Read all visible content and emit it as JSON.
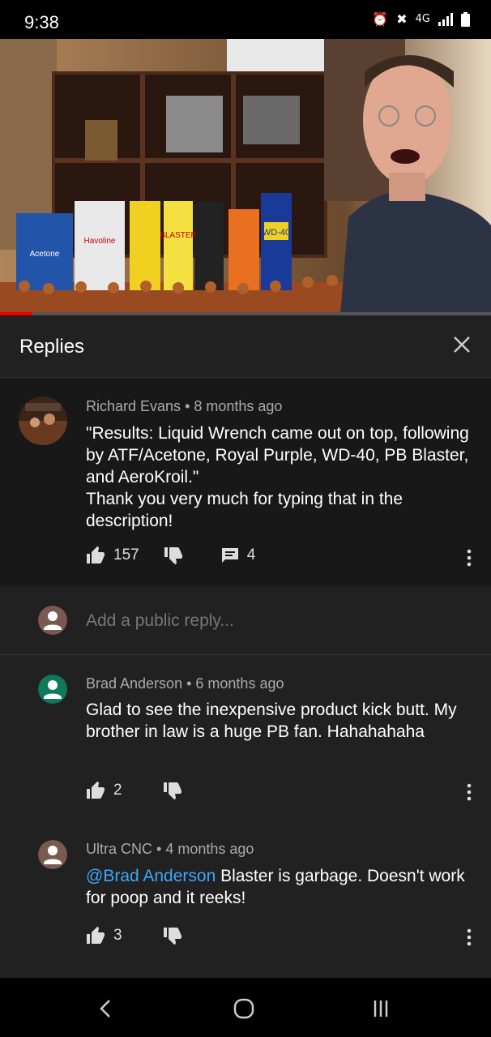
{
  "status_bar": {
    "time": "9:38",
    "network": "4G"
  },
  "replies_panel": {
    "title": "Replies"
  },
  "parent_comment": {
    "author": "Richard Evans",
    "age": "8 months ago",
    "text": "\"Results: Liquid Wrench came out on top, following by ATF/Acetone, Royal Purple, WD-40, PB Blaster, and AeroKroil.\"\nThank you very much for typing that in the description!",
    "likes": "157",
    "reply_count": "4"
  },
  "reply_input": {
    "placeholder": "Add a public reply..."
  },
  "replies": [
    {
      "author": "Brad Anderson",
      "age": "6 months ago",
      "text": "Glad to see the inexpensive product kick butt.   My brother in law is a huge PB fan. Hahahahaha",
      "likes": "2",
      "avatar_color": "#0f7a5a"
    },
    {
      "author": "Ultra CNC",
      "age": "4 months ago",
      "mention": "@Brad Anderson",
      "text": " Blaster is garbage. Doesn't work for poop and it reeks!",
      "likes": "3",
      "avatar_color": "#7a5a50"
    }
  ],
  "colors": {
    "panel_bg": "#212121",
    "parent_bg": "#181818",
    "mention": "#3ea6ff",
    "progress": "#ee0000"
  },
  "video_overlay_labels": {
    "wd40": "WD-40",
    "blaster": "BLASTER",
    "havoline": "Havoline",
    "acetone": "Acetone"
  }
}
